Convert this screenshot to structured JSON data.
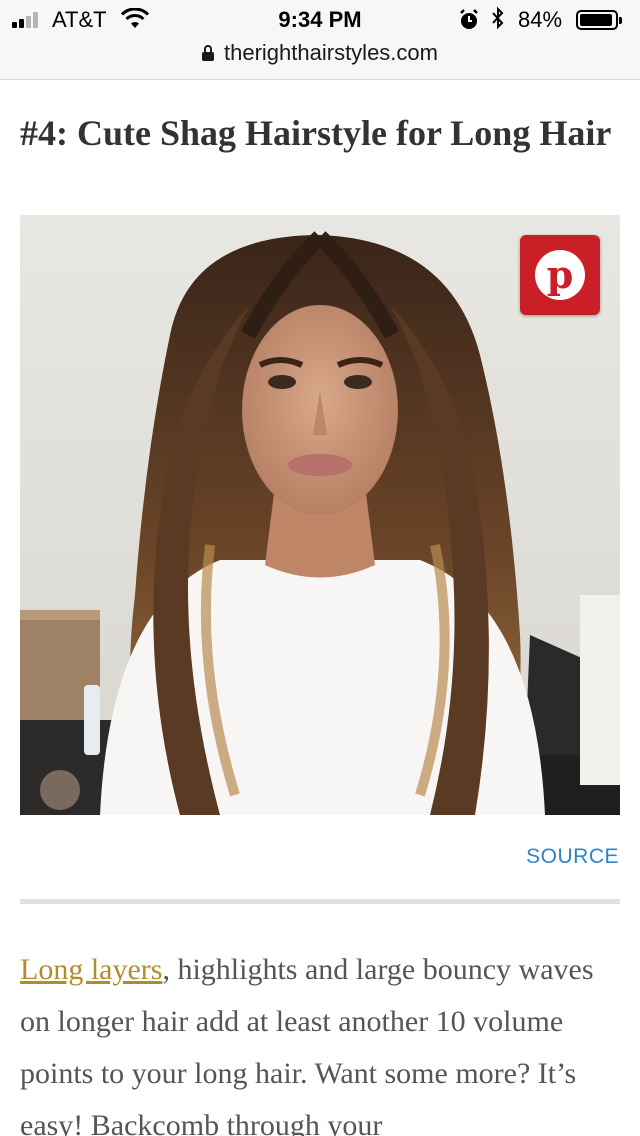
{
  "status_bar": {
    "carrier": "AT&T",
    "time": "9:34 PM",
    "battery_percent": "84%",
    "battery_level": 0.84,
    "signal_bars": 2,
    "icons": [
      "signal-icon",
      "wifi-icon",
      "alarm-icon",
      "bluetooth-icon",
      "battery-icon"
    ]
  },
  "url_bar": {
    "domain": "therighthairstyles.com",
    "icon": "lock-icon"
  },
  "article": {
    "heading": "#4: Cute Shag Hairstyle for Long Hair",
    "image": {
      "pin_button_letter": "p",
      "pin_button_icon": "pinterest-icon"
    },
    "source_link": "SOURCE",
    "paragraph": {
      "link_text": "Long layers",
      "text": ", highlights and large bouncy waves on longer hair add at least another 10 volume points to your long hair. Want some more? It’s easy! Backcomb through your"
    }
  },
  "colors": {
    "link_gold": "#b08d2c",
    "source_blue": "#2e84c8",
    "pinterest_red": "#cb1f27"
  }
}
